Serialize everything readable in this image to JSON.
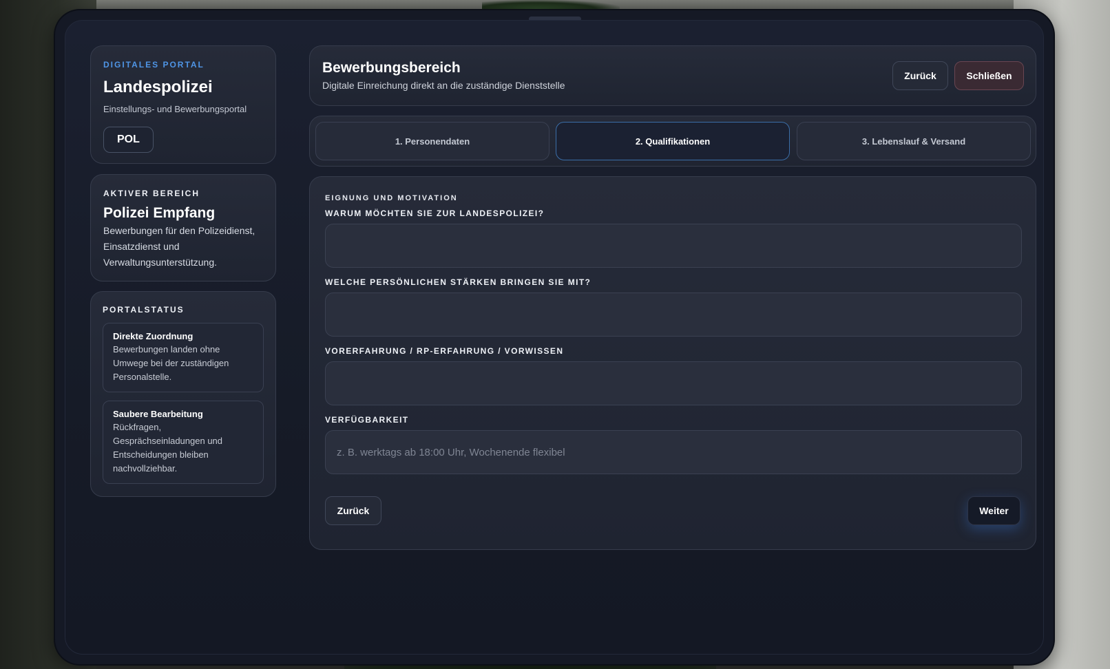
{
  "sidebar": {
    "brand": {
      "eyebrow": "DIGITALES PORTAL",
      "title": "Landespolizei",
      "subtitle": "Einstellungs- und Bewerbungsportal",
      "badge": "POL"
    },
    "active_area": {
      "eyebrow": "AKTIVER BEREICH",
      "title": "Polizei Empfang",
      "text": "Bewerbungen für den Polizeidienst, Einsatzdienst und Verwaltungsunterstützung."
    },
    "status": {
      "eyebrow": "PORTALSTATUS",
      "items": [
        {
          "title": "Direkte Zuordnung",
          "text": "Bewerbungen landen ohne Umwege bei der zuständigen Personalstelle."
        },
        {
          "title": "Saubere Bearbeitung",
          "text": "Rückfragen, Gesprächseinladungen und Entscheidungen bleiben nachvollziehbar."
        }
      ]
    }
  },
  "header": {
    "title": "Bewerbungsbereich",
    "subtitle": "Digitale Einreichung direkt an die zuständige Dienststelle",
    "back_label": "Zurück",
    "close_label": "Schließen"
  },
  "steps": [
    {
      "label": "1. Personendaten"
    },
    {
      "label": "2. Qualifikationen",
      "active": true
    },
    {
      "label": "3. Lebenslauf & Versand"
    }
  ],
  "form": {
    "section": "EIGNUNG UND MOTIVATION",
    "fields": [
      {
        "label": "WARUM MÖCHTEN SIE ZUR LANDESPOLIZEI?",
        "value": "",
        "placeholder": ""
      },
      {
        "label": "WELCHE PERSÖNLICHEN STÄRKEN BRINGEN SIE MIT?",
        "value": "",
        "placeholder": ""
      },
      {
        "label": "VORERFAHRUNG / RP-ERFAHRUNG / VORWISSEN",
        "value": "",
        "placeholder": ""
      },
      {
        "label": "VERFÜGBARKEIT",
        "value": "",
        "placeholder": "z. B. werktags ab 18:00 Uhr, Wochenende flexibel"
      }
    ],
    "back_label": "Zurück",
    "next_label": "Weiter"
  },
  "colors": {
    "accent_blue": "#4f95e6",
    "active_step_border": "#3b6ea8",
    "close_button_bg": "#3a2a33"
  }
}
